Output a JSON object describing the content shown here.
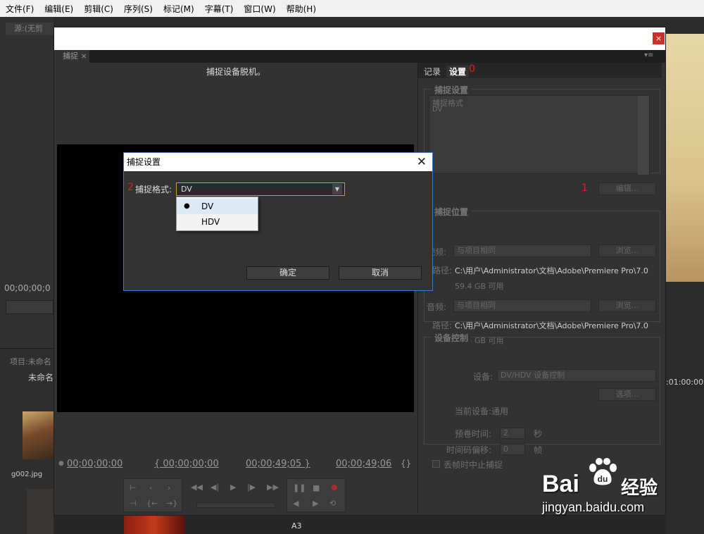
{
  "menubar": {
    "items": [
      "文件(F)",
      "编辑(E)",
      "剪辑(C)",
      "序列(S)",
      "标记(M)",
      "字幕(T)",
      "窗口(W)",
      "帮助(H)"
    ]
  },
  "background": {
    "source_tab": "源:(无剪",
    "timecode_left": "00;00;00;0",
    "project_tab": "项目:未命名",
    "project_name": "未命名",
    "thumb_label": "g002.jpg",
    "right_timecode": ":01:00:00",
    "track_label": "A3"
  },
  "capture": {
    "tab_label": "捕捉 ×",
    "close_glyph": "×",
    "menu_glyph": "▾≡",
    "offline_text": "捕捉设备脱机。",
    "tabs": {
      "record": "记录",
      "settings": "设置",
      "marker0": "0"
    },
    "capture_settings": {
      "title": "捕捉设置",
      "format_label": "捕捉格式",
      "format_value": "DV",
      "edit_button": "编辑...",
      "marker1": "1"
    },
    "capture_location": {
      "title": "捕捉位置",
      "video_label": "视频:",
      "video_value": "与项目相同",
      "browse1": "浏览...",
      "path_label1": "路径:",
      "path1": "C:\\用户\\Administrator\\文档\\Adobe\\Premiere Pro\\7.0",
      "free1": "59.4 GB 可用",
      "audio_label": "音频:",
      "audio_value": "与项目相同",
      "browse2": "浏览...",
      "path_label2": "路径:",
      "path2": "C:\\用户\\Administrator\\文档\\Adobe\\Premiere Pro\\7.0",
      "free2": "59.4 GB 可用"
    },
    "device_control": {
      "title": "设备控制",
      "device_label": "设备:",
      "device_value": "DV/HDV 设备控制",
      "options_button": "选项...",
      "current_device": "当前设备:通用",
      "preroll_label": "预卷时间:",
      "preroll_value": "2",
      "preroll_unit": "秒",
      "offset_label": "时间码偏移:",
      "offset_value": "0",
      "offset_unit": "帧",
      "abort_label": "丢帧时中止捕捉"
    },
    "timecodes": {
      "current": "00;00;00;00",
      "in": "{ 00;00;00;00",
      "out": "00;00;49;05 }",
      "duration": "00;00;49;06"
    }
  },
  "dialog": {
    "title": "捕捉设置",
    "close_glyph": "✕",
    "marker2": "2",
    "format_label": "捕捉格式:",
    "format_value": "DV",
    "options": [
      "DV",
      "HDV"
    ],
    "ok_button": "确定",
    "cancel_button": "取消"
  },
  "watermark": {
    "bai": "Bai",
    "du": "du",
    "jingyan": "经验",
    "url": "jingyan.baidu.com"
  }
}
